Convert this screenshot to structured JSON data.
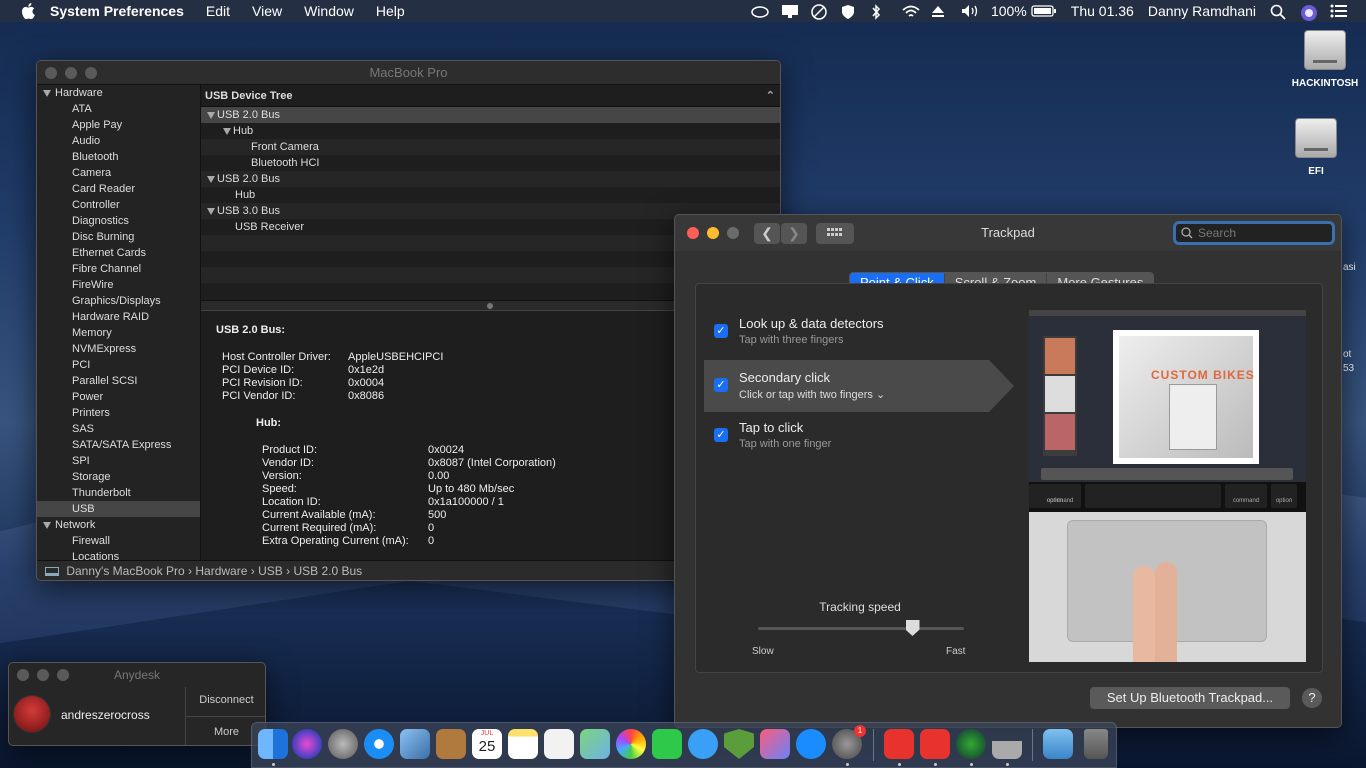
{
  "menubar": {
    "app_name": "System Preferences",
    "menus": [
      "Edit",
      "View",
      "Window",
      "Help"
    ],
    "battery": "100%",
    "clock": "Thu 01.36",
    "user": "Danny Ramdhani"
  },
  "desktop": {
    "icons": [
      "HACKINTOSH",
      "EFI"
    ],
    "partial_texts": [
      "asi",
      "ot",
      "53"
    ]
  },
  "sysinfo": {
    "title": "MacBook Pro",
    "sidebar": {
      "hardware_header": "Hardware",
      "hardware_items": [
        "ATA",
        "Apple Pay",
        "Audio",
        "Bluetooth",
        "Camera",
        "Card Reader",
        "Controller",
        "Diagnostics",
        "Disc Burning",
        "Ethernet Cards",
        "Fibre Channel",
        "FireWire",
        "Graphics/Displays",
        "Hardware RAID",
        "Memory",
        "NVMExpress",
        "PCI",
        "Parallel SCSI",
        "Power",
        "Printers",
        "SAS",
        "SATA/SATA Express",
        "SPI",
        "Storage",
        "Thunderbolt",
        "USB"
      ],
      "selected": "USB",
      "network_header": "Network",
      "network_items": [
        "Firewall",
        "Locations"
      ]
    },
    "tree": {
      "header": "USB Device Tree",
      "rows": [
        {
          "label": "USB 2.0 Bus",
          "level": 0,
          "expanded": true
        },
        {
          "label": "Hub",
          "level": 1,
          "expanded": true
        },
        {
          "label": "Front Camera",
          "level": 2
        },
        {
          "label": "Bluetooth HCI",
          "level": 2
        },
        {
          "label": "USB 2.0 Bus",
          "level": 0,
          "expanded": true
        },
        {
          "label": "Hub",
          "level": 1
        },
        {
          "label": "USB 3.0 Bus",
          "level": 0,
          "expanded": true
        },
        {
          "label": "USB Receiver",
          "level": 1
        }
      ]
    },
    "detail": {
      "heading": "USB 2.0 Bus:",
      "bus_props": [
        [
          "Host Controller Driver:",
          "AppleUSBEHCIPCI"
        ],
        [
          "PCI Device ID:",
          "0x1e2d"
        ],
        [
          "PCI Revision ID:",
          "0x0004"
        ],
        [
          "PCI Vendor ID:",
          "0x8086"
        ]
      ],
      "sub_heading": "Hub:",
      "hub_props": [
        [
          "Product ID:",
          "0x0024"
        ],
        [
          "Vendor ID:",
          "0x8087  (Intel Corporation)"
        ],
        [
          "Version:",
          "0.00"
        ],
        [
          "Speed:",
          "Up to 480 Mb/sec"
        ],
        [
          "Location ID:",
          "0x1a100000 / 1"
        ],
        [
          "Current Available (mA):",
          "500"
        ],
        [
          "Current Required (mA):",
          "0"
        ],
        [
          "Extra Operating Current (mA):",
          "0"
        ]
      ]
    },
    "pathbar": [
      "Danny's MacBook Pro",
      "Hardware",
      "USB",
      "USB 2.0 Bus"
    ]
  },
  "trackpad": {
    "title": "Trackpad",
    "search_placeholder": "Search",
    "tabs": [
      "Point & Click",
      "Scroll & Zoom",
      "More Gestures"
    ],
    "active_tab": "Point & Click",
    "options": [
      {
        "title": "Look up & data detectors",
        "subtitle": "Tap with three fingers",
        "checked": true
      },
      {
        "title": "Secondary click",
        "subtitle": "Click or tap with two fingers",
        "checked": true,
        "selected": true
      },
      {
        "title": "Tap to click",
        "subtitle": "Tap with one finger",
        "checked": true
      }
    ],
    "tracking_label": "Tracking speed",
    "slow_label": "Slow",
    "fast_label": "Fast",
    "tracking_value": 0.75,
    "preview_text": "CUSTOM BIKES",
    "key_labels": [
      "command",
      "command",
      "option",
      "option"
    ],
    "setup_button": "Set Up Bluetooth Trackpad...",
    "help_button": "?"
  },
  "anydesk": {
    "title": "Anydesk",
    "username": "andreszerocross",
    "disconnect": "Disconnect",
    "more": "More"
  },
  "dock": {
    "calendar_month": "JUL",
    "calendar_day": "25",
    "badge": "1"
  }
}
